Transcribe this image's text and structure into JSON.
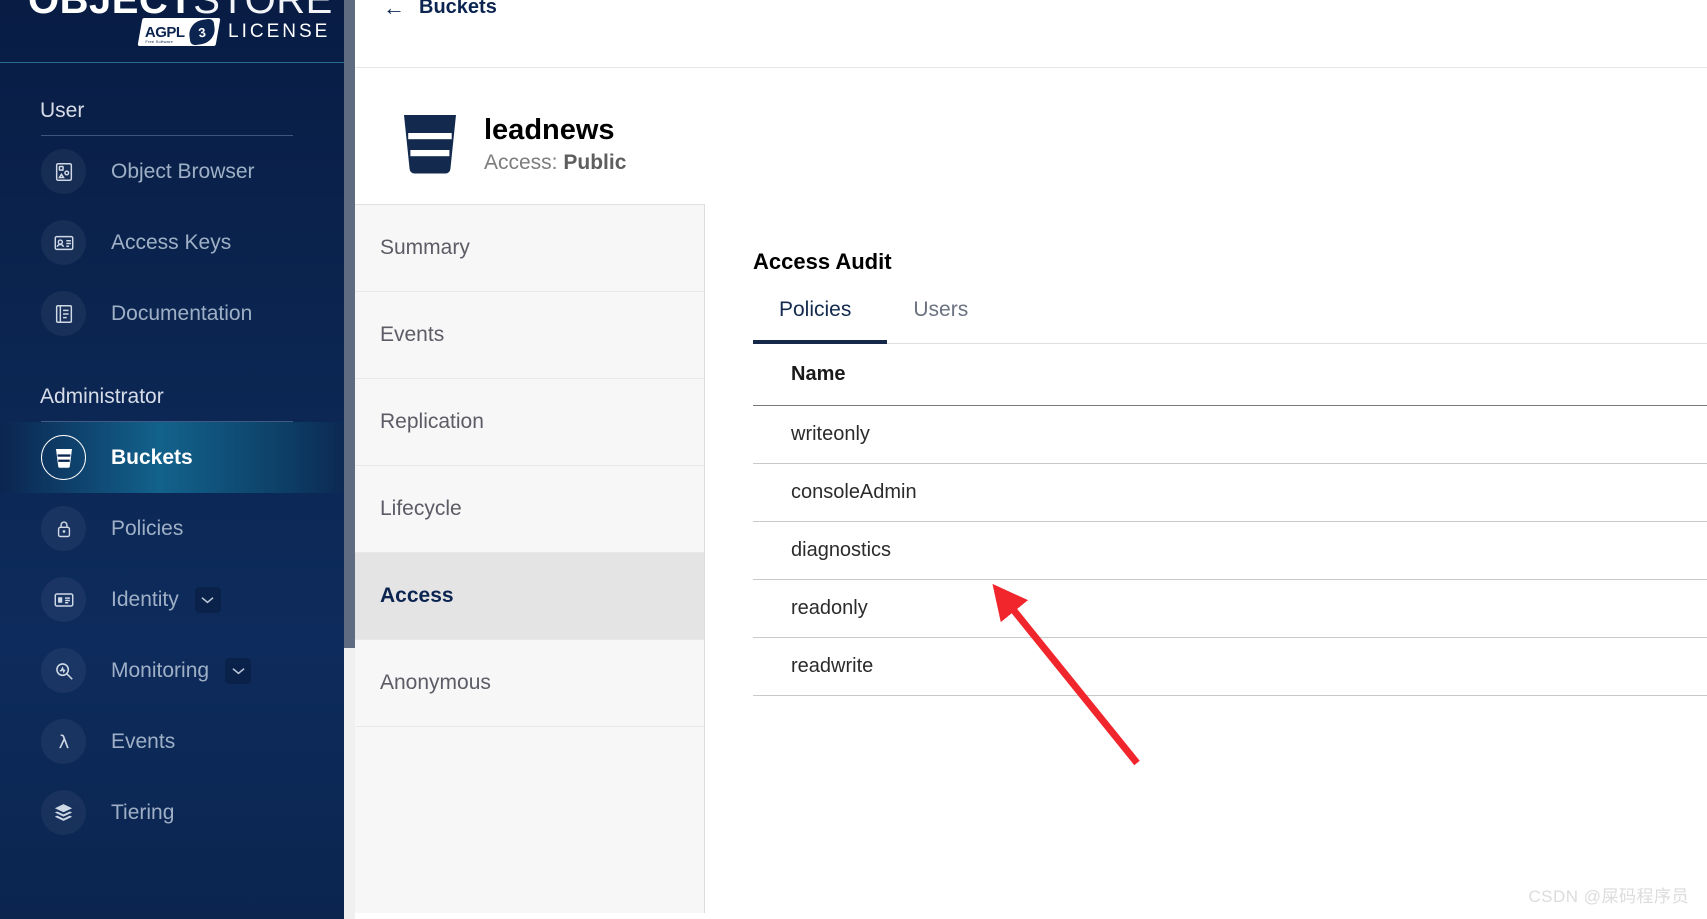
{
  "sidebar": {
    "logo": {
      "word_bold": "OBJECT",
      "word_thin": "STORE",
      "badge_text": "AGPL",
      "badge_fine": "Free Software",
      "badge_mark": "3",
      "license_label": "LICENSE"
    },
    "sections": [
      {
        "title": "User",
        "items": [
          {
            "label": "Object Browser",
            "icon": "object-browser-icon",
            "active": false,
            "caret": false
          },
          {
            "label": "Access Keys",
            "icon": "access-keys-icon",
            "active": false,
            "caret": false
          },
          {
            "label": "Documentation",
            "icon": "documentation-icon",
            "active": false,
            "caret": false
          }
        ]
      },
      {
        "title": "Administrator",
        "items": [
          {
            "label": "Buckets",
            "icon": "bucket-icon",
            "active": true,
            "caret": false
          },
          {
            "label": "Policies",
            "icon": "lock-icon",
            "active": false,
            "caret": false
          },
          {
            "label": "Identity",
            "icon": "identity-icon",
            "active": false,
            "caret": true
          },
          {
            "label": "Monitoring",
            "icon": "monitoring-icon",
            "active": false,
            "caret": true
          },
          {
            "label": "Events",
            "icon": "lambda-icon",
            "active": false,
            "caret": false
          },
          {
            "label": "Tiering",
            "icon": "tiering-icon",
            "active": false,
            "caret": false
          }
        ]
      }
    ]
  },
  "breadcrumb": {
    "back_icon": "arrow-left-icon",
    "label": "Buckets"
  },
  "bucket": {
    "icon": "bucket-icon",
    "name": "leadnews",
    "access_label": "Access:",
    "access_value": "Public"
  },
  "vertical_tabs": [
    {
      "label": "Summary",
      "active": false
    },
    {
      "label": "Events",
      "active": false
    },
    {
      "label": "Replication",
      "active": false
    },
    {
      "label": "Lifecycle",
      "active": false
    },
    {
      "label": "Access",
      "active": true
    },
    {
      "label": "Anonymous",
      "active": false
    }
  ],
  "panel": {
    "title": "Access Audit",
    "tabs": [
      {
        "label": "Policies",
        "active": true
      },
      {
        "label": "Users",
        "active": false
      }
    ],
    "table": {
      "columns": [
        "Name"
      ],
      "rows": [
        [
          "writeonly"
        ],
        [
          "consoleAdmin"
        ],
        [
          "diagnostics"
        ],
        [
          "readonly"
        ],
        [
          "readwrite"
        ]
      ]
    }
  },
  "annotation": {
    "type": "arrow",
    "color": "#f0262c",
    "points_to_row": "readonly"
  },
  "watermark": "CSDN @屎码程序员",
  "colors": {
    "sidebar_dark": "#0b2550",
    "sidebar_accent": "#12628c",
    "brand_navy": "#0b2550",
    "annotation_red": "#f0262c"
  }
}
